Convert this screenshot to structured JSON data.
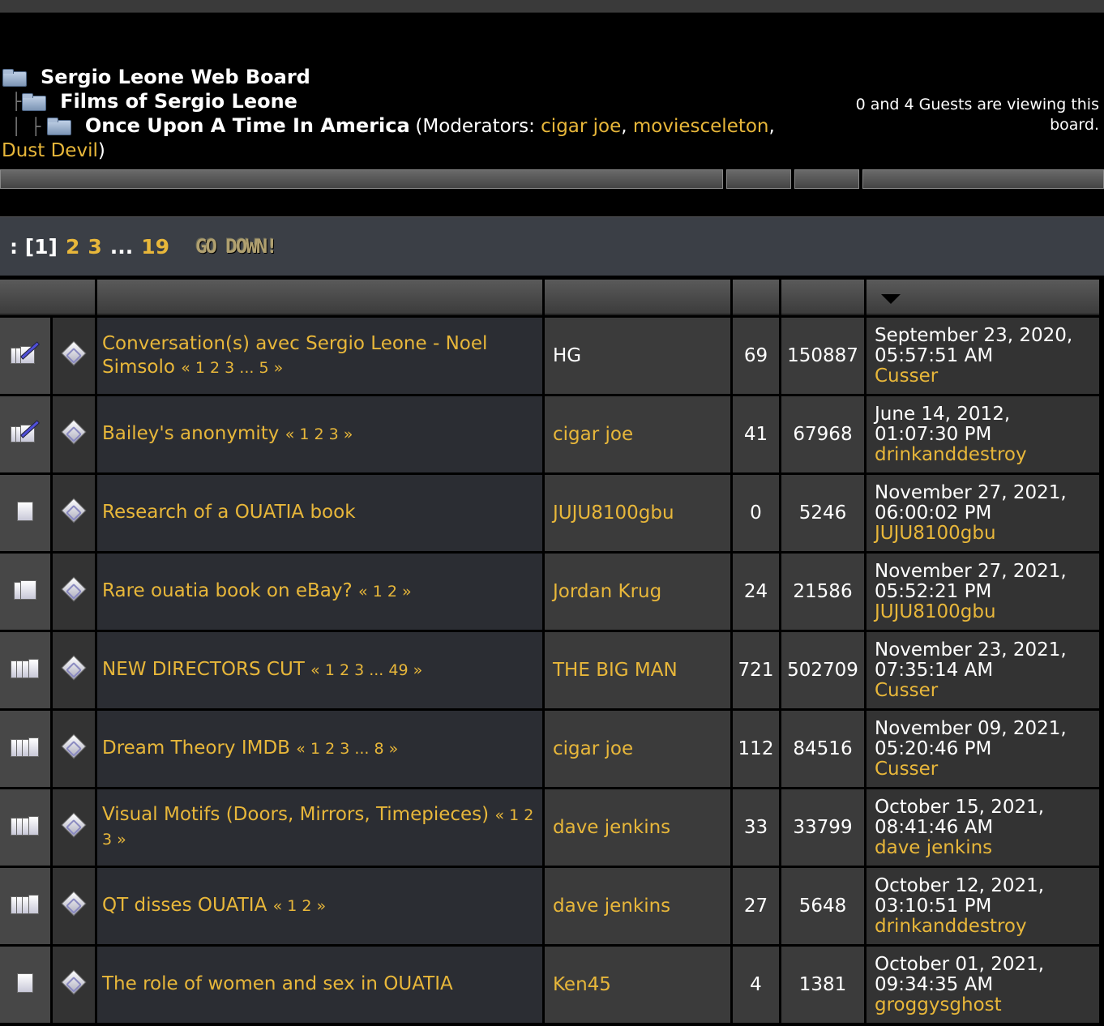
{
  "board": {
    "root": "Sergio Leone Web Board",
    "category": "Films of Sergio Leone",
    "current": "Once Upon A Time In America",
    "moderators_prefix": "(Moderators: ",
    "moderators": [
      "cigar joe",
      "moviesceleton",
      "Dust Devil"
    ],
    "moderators_suffix": ")",
    "guests_text": "0 and 4 Guests are viewing this board."
  },
  "pagination": {
    "prefix": ": [1]",
    "pages": [
      "2",
      "3"
    ],
    "ellipsis": "...",
    "last": "19",
    "go_down": "GO DOWN!"
  },
  "icons": {
    "sort": "sort-desc-icon",
    "folder": "folder-icon",
    "topic": "topic-status-icon",
    "message": "message-diamond-icon"
  },
  "colors": {
    "link": "#e8b73a",
    "background": "#000000",
    "subject_cell": "#2b2d33"
  },
  "topics": [
    {
      "icon": "sticky",
      "subject": "Conversation(s) avec Sergio Leone - Noel Simsolo",
      "pages": "« 1 2 3 ... 5 »",
      "starter": "HG",
      "starter_link": false,
      "replies": "69",
      "views": "150887",
      "last_date": "September 23, 2020, 05:57:51 AM",
      "last_user": "Cusser"
    },
    {
      "icon": "sticky",
      "subject": "Bailey's anonymity",
      "pages": "« 1 2 3 »",
      "starter": "cigar joe",
      "starter_link": true,
      "replies": "41",
      "views": "67968",
      "last_date": "June 14, 2012, 01:07:30 PM",
      "last_user": "drinkanddestroy"
    },
    {
      "icon": "normal",
      "subject": "Research of a OUATIA book",
      "pages": "",
      "starter": "JUJU8100gbu",
      "starter_link": true,
      "replies": "0",
      "views": "5246",
      "last_date": "November 27, 2021, 06:00:02 PM",
      "last_user": "JUJU8100gbu"
    },
    {
      "icon": "hot",
      "subject": "Rare ouatia book on eBay?",
      "pages": "« 1 2 »",
      "starter": "Jordan Krug",
      "starter_link": true,
      "replies": "24",
      "views": "21586",
      "last_date": "November 27, 2021, 05:52:21 PM",
      "last_user": "JUJU8100gbu"
    },
    {
      "icon": "veryhot",
      "subject": "NEW DIRECTORS CUT",
      "pages": "« 1 2 3 ... 49 »",
      "starter": "THE BIG MAN",
      "starter_link": true,
      "replies": "721",
      "views": "502709",
      "last_date": "November 23, 2021, 07:35:14 AM",
      "last_user": "Cusser"
    },
    {
      "icon": "veryhot",
      "subject": "Dream Theory IMDB",
      "pages": "« 1 2 3 ... 8 »",
      "starter": "cigar joe",
      "starter_link": true,
      "replies": "112",
      "views": "84516",
      "last_date": "November 09, 2021, 05:20:46 PM",
      "last_user": "Cusser"
    },
    {
      "icon": "veryhot",
      "subject": "Visual Motifs (Doors, Mirrors, Timepieces)",
      "pages": "« 1 2 3 »",
      "starter": "dave jenkins",
      "starter_link": true,
      "replies": "33",
      "views": "33799",
      "last_date": "October 15, 2021, 08:41:46 AM",
      "last_user": "dave jenkins"
    },
    {
      "icon": "veryhot",
      "subject": "QT disses OUATIA",
      "pages": "« 1 2 »",
      "starter": "dave jenkins",
      "starter_link": true,
      "replies": "27",
      "views": "5648",
      "last_date": "October 12, 2021, 03:10:51 PM",
      "last_user": "drinkanddestroy"
    },
    {
      "icon": "normal",
      "subject": "The role of women and sex in OUATIA",
      "pages": "",
      "starter": "Ken45",
      "starter_link": true,
      "replies": "4",
      "views": "1381",
      "last_date": "October 01, 2021, 09:34:35 AM",
      "last_user": "groggysghost"
    }
  ]
}
